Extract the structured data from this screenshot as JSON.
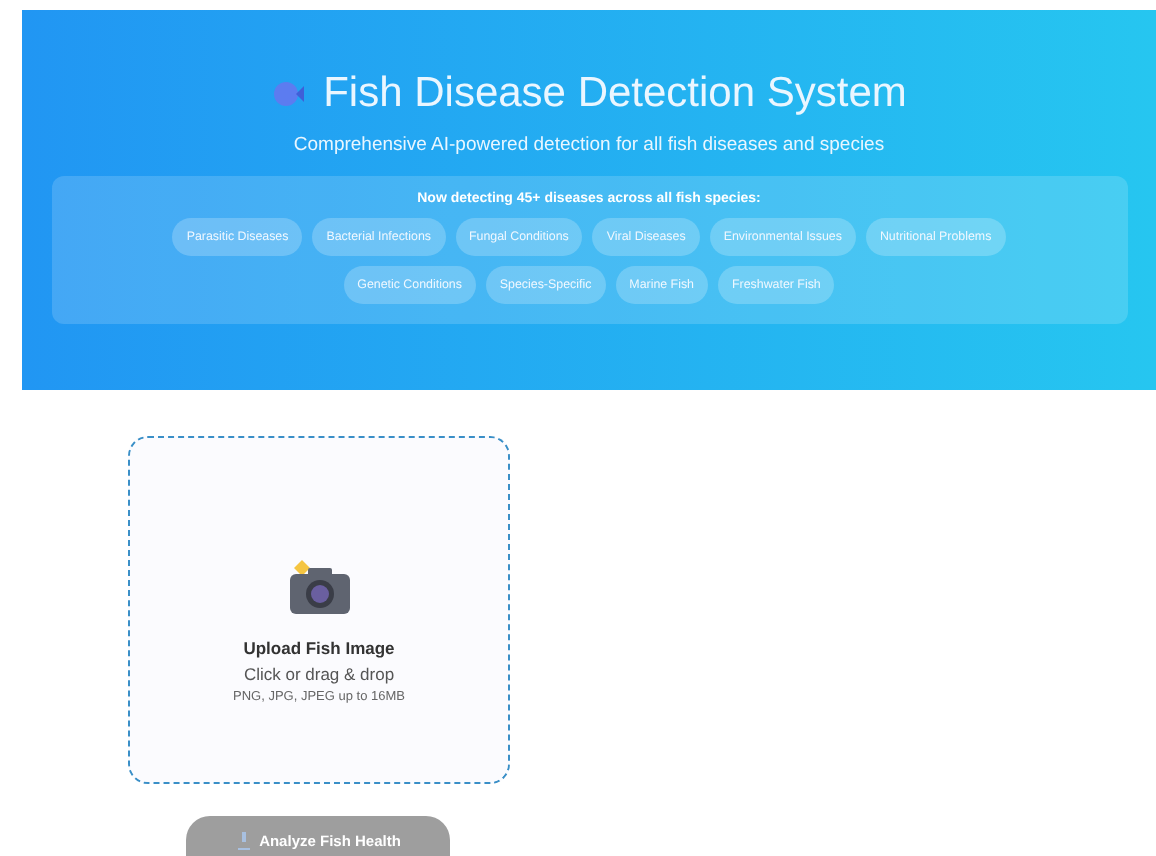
{
  "header": {
    "title": "Fish Disease Detection System",
    "subtitle": "Comprehensive AI-powered detection for all fish diseases and species"
  },
  "coverage": {
    "heading": "Now detecting 45+ diseases across all fish species:",
    "tags": [
      "Parasitic Diseases",
      "Bacterial Infections",
      "Fungal Conditions",
      "Viral Diseases",
      "Environmental Issues",
      "Nutritional Problems",
      "Genetic Conditions",
      "Species-Specific",
      "Marine Fish",
      "Freshwater Fish"
    ]
  },
  "upload": {
    "title": "Upload Fish Image",
    "hint": "Click or drag & drop",
    "formats": "PNG, JPG, JPEG up to 16MB"
  },
  "analyze_button": {
    "label": "Analyze Fish Health",
    "disabled": true
  }
}
